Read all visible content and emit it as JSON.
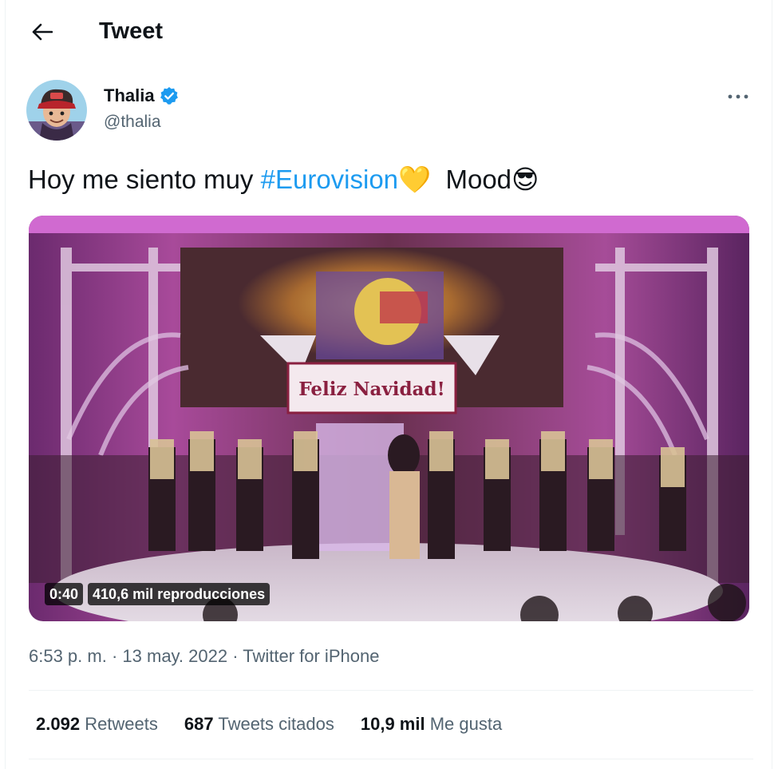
{
  "header": {
    "back_icon": "arrow-left-icon",
    "title": "Tweet"
  },
  "author": {
    "display_name": "Thalia",
    "handle": "@thalia",
    "verified_icon": "verified-badge-icon",
    "avatar_icon": "avatar",
    "more_icon": "more-horizontal-icon"
  },
  "tweet": {
    "text_before": "Hoy me siento muy ",
    "hashtag": "#Eurovision",
    "heart_emoji": "💛",
    "text_after": "Mood",
    "sunglasses_emoji": "😎"
  },
  "media": {
    "sign_text": "Feliz Navidad!",
    "duration": "0:40",
    "views": "410,6 mil reproducciones"
  },
  "meta": {
    "time": "6:53 p. m.",
    "sep1": " · ",
    "date": "13 may. 2022",
    "sep2": " · ",
    "source": "Twitter for iPhone"
  },
  "stats": [
    {
      "count": "2.092",
      "label": "Retweets"
    },
    {
      "count": "687",
      "label": "Tweets citados"
    },
    {
      "count": "10,9 mil",
      "label": "Me gusta"
    }
  ],
  "colors": {
    "accent": "#1d9bf0",
    "secondary_text": "#536471",
    "primary_text": "#0f1419"
  }
}
